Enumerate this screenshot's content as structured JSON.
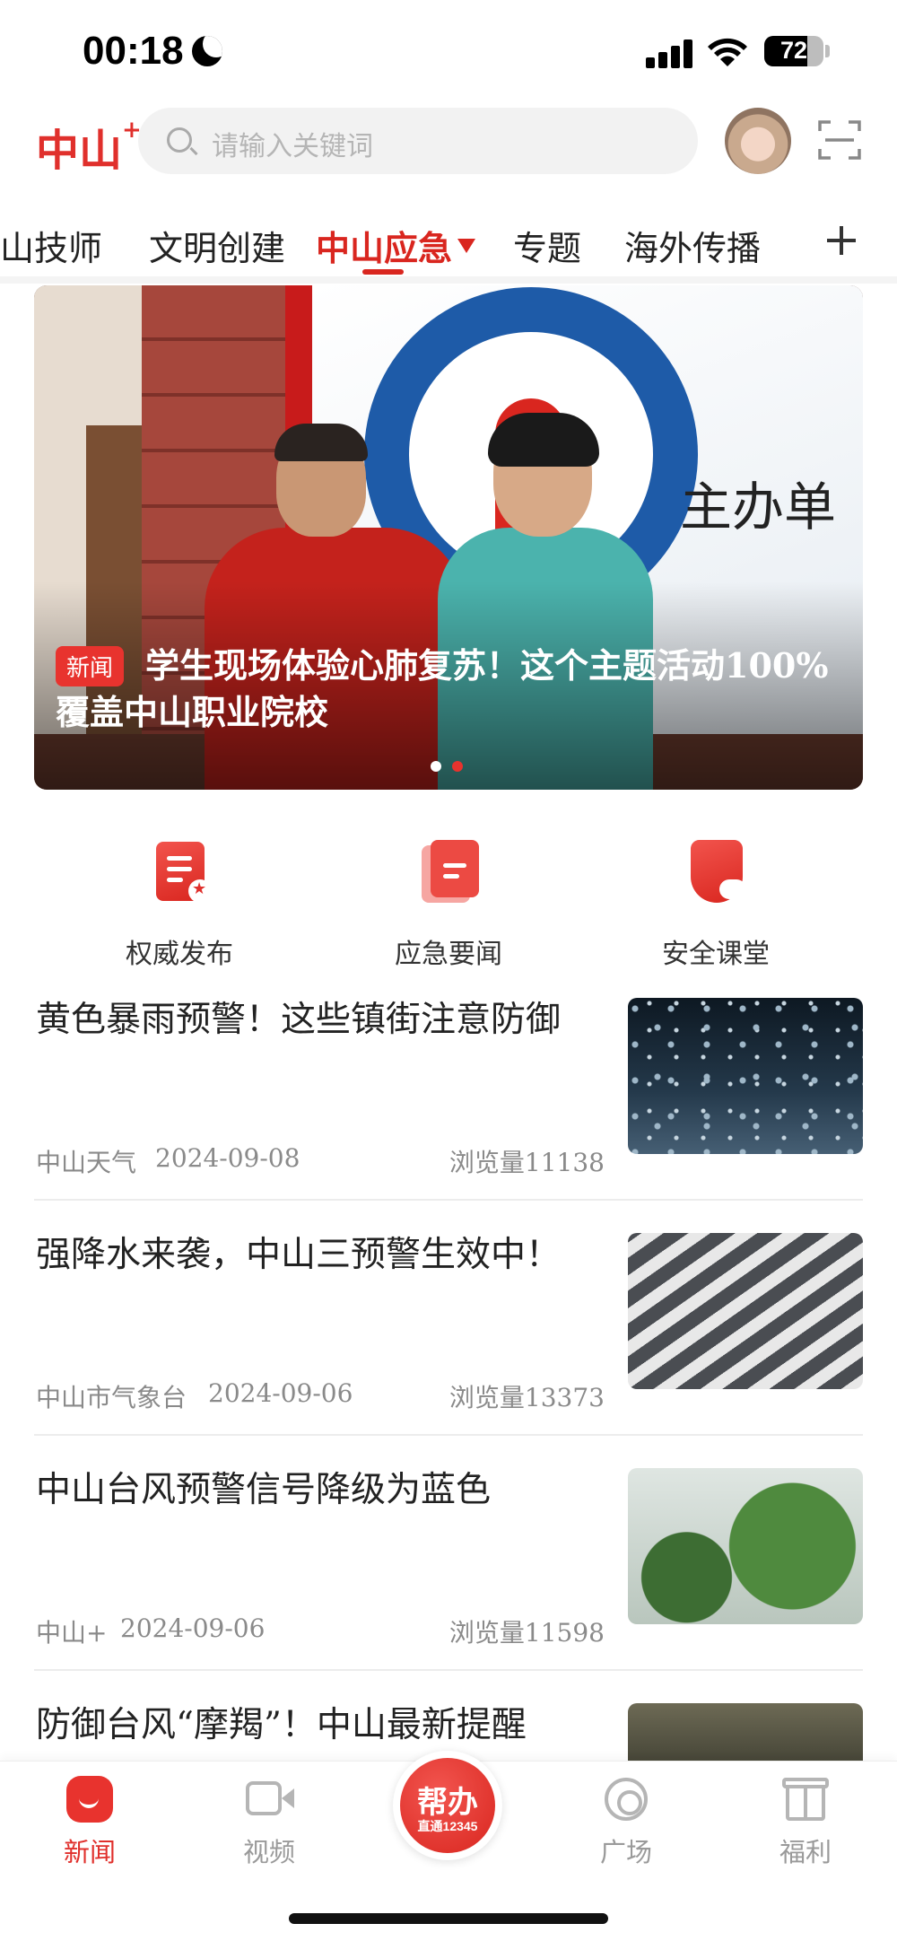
{
  "status_bar": {
    "time": "00:18",
    "battery": "72",
    "battery_level": 0.72
  },
  "header": {
    "logo": "中山",
    "logo_plus": "+",
    "search_placeholder": "请输入关键词"
  },
  "tabs": [
    {
      "label": "山技师",
      "active": false
    },
    {
      "label": "文明创建",
      "active": false
    },
    {
      "label": "中山应急",
      "active": true
    },
    {
      "label": "专题",
      "active": false
    },
    {
      "label": "海外传播",
      "active": false
    }
  ],
  "banner": {
    "tag": "新闻",
    "title": "学生现场体验心肺复苏！这个主题活动100%覆盖中山职业院校",
    "screen_text": "主办单",
    "slide_count": 2,
    "active_slide": 2
  },
  "quick_links": [
    {
      "label": "权威发布",
      "icon": "authoritative-release-icon"
    },
    {
      "label": "应急要闻",
      "icon": "emergency-news-icon"
    },
    {
      "label": "安全课堂",
      "icon": "safety-class-icon"
    }
  ],
  "news": [
    {
      "title": "黄色暴雨预警！这些镇街注意防御",
      "source": "中山天气",
      "date": "2024-09-08",
      "views": "浏览量11138",
      "thumb": "heavy-rain"
    },
    {
      "title": "强降水来袭，中山三预警生效中！",
      "source": "中山市气象台",
      "date": "2024-09-06",
      "views": "浏览量13373",
      "thumb": "crosswalk-umbrellas"
    },
    {
      "title": "中山台风预警信号降级为蓝色",
      "source": "中山+",
      "date": "2024-09-06",
      "views": "浏览量11598",
      "thumb": "rain-on-window"
    },
    {
      "title": "防御台风“摩羯”！中山最新提醒",
      "source": "",
      "date": "",
      "views": "",
      "thumb": "satellite-cloud"
    }
  ],
  "bottom_nav": {
    "items": [
      {
        "label": "新闻",
        "active": true
      },
      {
        "label": "视频",
        "active": false
      },
      {
        "label": "广场",
        "active": false
      },
      {
        "label": "福利",
        "active": false
      }
    ],
    "center": {
      "main": "帮办",
      "sub": "直通12345"
    }
  },
  "colors": {
    "accent": "#d9261f",
    "muted": "#8a8a8a"
  }
}
